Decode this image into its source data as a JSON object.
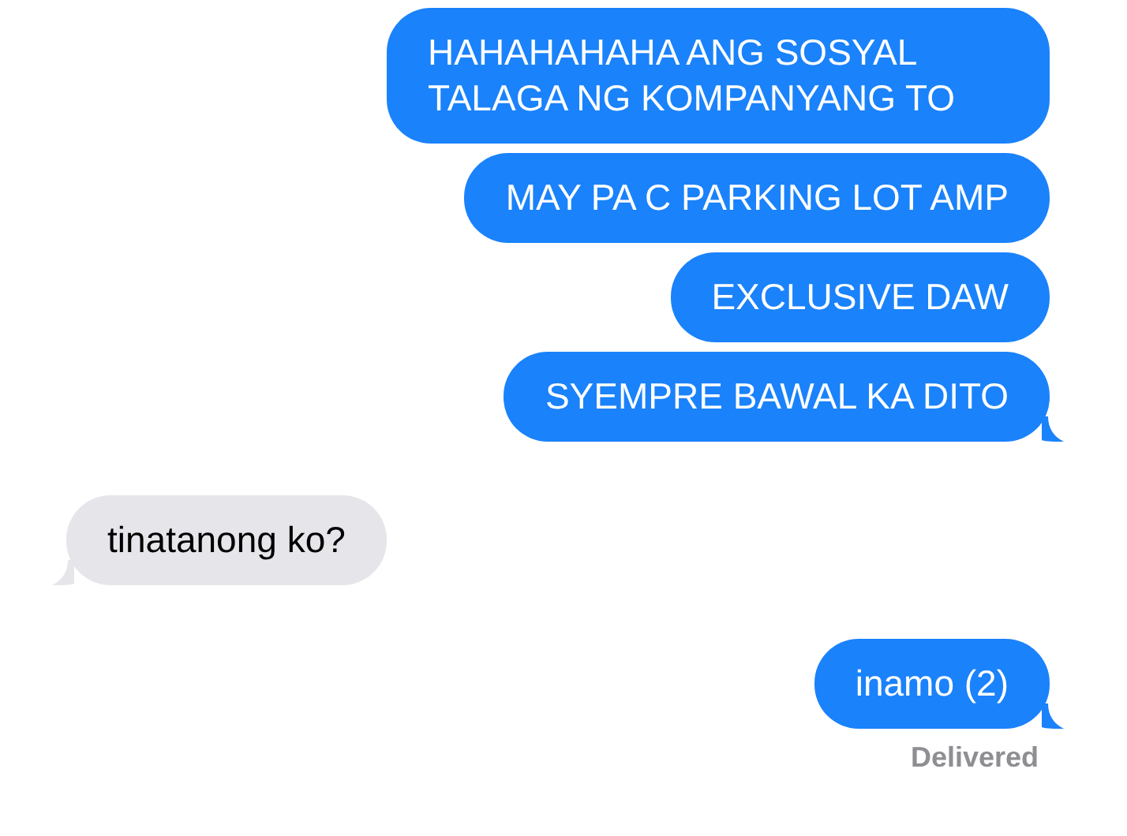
{
  "messages": [
    {
      "kind": "sent",
      "text": "HAHAHAHAHA ANG SOSYAL TALAGA NG KOMPANYANG TO",
      "tail": false
    },
    {
      "kind": "sent",
      "text": "MAY PA C PARKING LOT AMP",
      "tail": false
    },
    {
      "kind": "sent",
      "text": "EXCLUSIVE DAW",
      "tail": false
    },
    {
      "kind": "sent",
      "text": "SYEMPRE BAWAL KA DITO",
      "tail": true
    },
    {
      "kind": "received",
      "text": "tinatanong ko?",
      "tail": true
    },
    {
      "kind": "sent",
      "text": "inamo (2)",
      "tail": true
    }
  ],
  "status": "Delivered"
}
